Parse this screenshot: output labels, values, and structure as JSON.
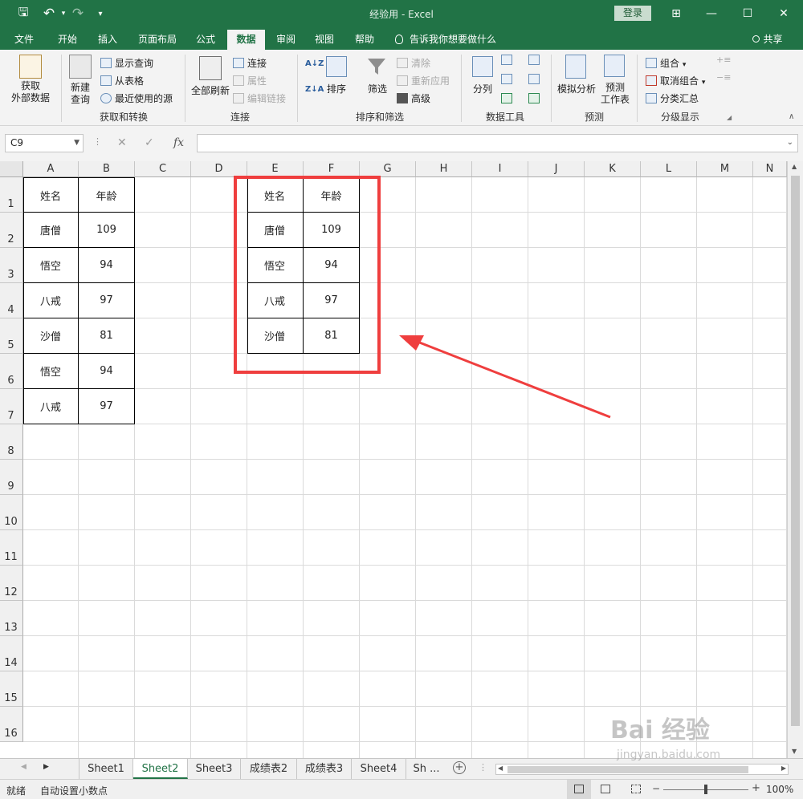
{
  "titlebar": {
    "title": "经验用  -  Excel",
    "login": "登录",
    "save_glyph": "🖫",
    "undo_glyph": "↶",
    "redo_glyph": "↷",
    "customize_glyph": "▾",
    "ribbon_opts_glyph": "⊞",
    "minimize_glyph": "—",
    "restore_glyph": "☐",
    "close_glyph": "✕"
  },
  "tabs": [
    "文件",
    "开始",
    "插入",
    "页面布局",
    "公式",
    "数据",
    "审阅",
    "视图",
    "帮助"
  ],
  "active_tab": "数据",
  "tellme": "告诉我你想要做什么",
  "share": "共享",
  "ribbon": {
    "get_external": "获取\n外部数据",
    "new_query": "新建\n查询",
    "show_query": "显示查询",
    "from_table": "从表格",
    "recent_sources": "最近使用的源",
    "group_get_transform": "获取和转换",
    "refresh_all": "全部刷新",
    "connections": "连接",
    "properties": "属性",
    "edit_links": "编辑链接",
    "group_connections": "连接",
    "sort": "排序",
    "filter": "筛选",
    "clear": "清除",
    "reapply": "重新应用",
    "advanced": "高级",
    "group_sort_filter": "排序和筛选",
    "text_to_columns": "分列",
    "group_data_tools": "数据工具",
    "what_if": "模拟分析",
    "forecast_sheet": "预测\n工作表",
    "group_forecast": "预测",
    "group": "组合",
    "ungroup": "取消组合",
    "subtotal": "分类汇总",
    "group_outline": "分级显示"
  },
  "formula_bar": {
    "name_box": "C9",
    "cancel_glyph": "✕",
    "enter_glyph": "✓",
    "fx_glyph": "fx",
    "value": ""
  },
  "grid": {
    "columns": [
      "A",
      "B",
      "C",
      "D",
      "E",
      "F",
      "G",
      "H",
      "I",
      "J",
      "K",
      "L",
      "M",
      "N"
    ],
    "rows": [
      "1",
      "2",
      "3",
      "4",
      "5",
      "6",
      "7",
      "8",
      "9",
      "10",
      "11",
      "12",
      "13",
      "14",
      "15",
      "16"
    ],
    "table_left": {
      "header": [
        "姓名",
        "年龄"
      ],
      "rows": [
        [
          "唐僧",
          "109"
        ],
        [
          "悟空",
          "94"
        ],
        [
          "八戒",
          "97"
        ],
        [
          "沙僧",
          "81"
        ],
        [
          "悟空",
          "94"
        ],
        [
          "八戒",
          "97"
        ]
      ]
    },
    "table_right": {
      "header": [
        "姓名",
        "年龄"
      ],
      "rows": [
        [
          "唐僧",
          "109"
        ],
        [
          "悟空",
          "94"
        ],
        [
          "八戒",
          "97"
        ],
        [
          "沙僧",
          "81"
        ]
      ]
    }
  },
  "sheets": [
    "Sheet1",
    "Sheet2",
    "Sheet3",
    "成绩表2",
    "成绩表3",
    "Sheet4",
    "Sh ..."
  ],
  "active_sheet": "Sheet2",
  "status": {
    "ready": "就绪",
    "auto_decimal": "自动设置小数点",
    "zoom": "100%"
  },
  "watermark": {
    "brand": "Bai 经验",
    "url": "jingyan.baidu.com"
  },
  "colors": {
    "excel_green": "#217346",
    "annotation_red": "#ef3e3e"
  }
}
